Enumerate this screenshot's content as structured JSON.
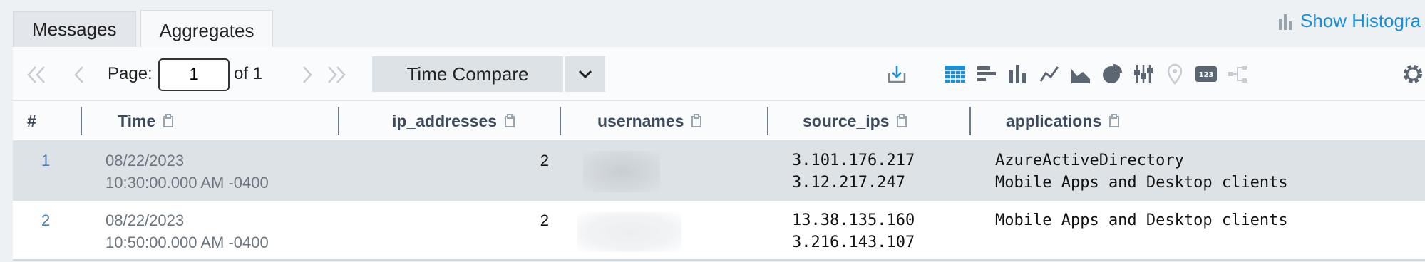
{
  "tabs": [
    {
      "label": "Messages",
      "active": false
    },
    {
      "label": "Aggregates",
      "active": true
    }
  ],
  "histogram_link": "Show Histogra",
  "toolbar": {
    "page_label": "Page:",
    "page_value": "1",
    "of_label": "of 1",
    "time_compare": "Time Compare",
    "view_icons": [
      "download-icon",
      "table-icon",
      "bar-chart-icon",
      "column-chart-icon",
      "line-chart-icon",
      "area-chart-icon",
      "pie-chart-icon",
      "box-plot-icon",
      "map-pin-icon",
      "number-icon",
      "flow-icon",
      "settings-icon"
    ]
  },
  "table": {
    "columns": [
      {
        "key": "num",
        "label": "#"
      },
      {
        "key": "time",
        "label": "Time"
      },
      {
        "key": "ip_addresses",
        "label": "ip_addresses"
      },
      {
        "key": "usernames",
        "label": "usernames"
      },
      {
        "key": "source_ips",
        "label": "source_ips"
      },
      {
        "key": "applications",
        "label": "applications"
      }
    ],
    "rows": [
      {
        "num": "1",
        "time_date": "08/22/2023",
        "time_clock": "10:30:00.000 AM -0400",
        "ip_addresses": "2",
        "source_ips": [
          "3.101.176.217",
          "3.12.217.247"
        ],
        "applications": [
          "AzureActiveDirectory",
          "Mobile Apps and Desktop clients"
        ]
      },
      {
        "num": "2",
        "time_date": "08/22/2023",
        "time_clock": "10:50:00.000 AM -0400",
        "ip_addresses": "2",
        "source_ips": [
          "13.38.135.160",
          "3.216.143.107"
        ],
        "applications": [
          "Mobile Apps and Desktop clients",
          ""
        ]
      }
    ]
  },
  "colors": {
    "accent": "#1a8fd8",
    "header_text": "#3c4a5c",
    "row_selected": "#dde2e7",
    "row_number": "#4a7fb0"
  }
}
